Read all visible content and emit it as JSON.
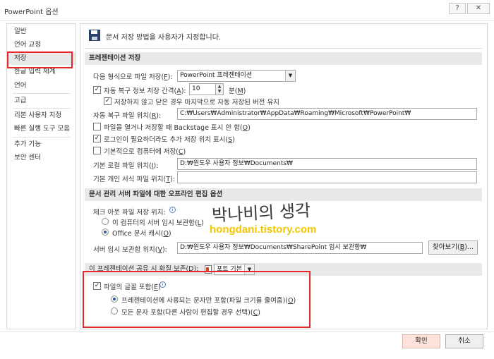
{
  "window": {
    "title": "PowerPoint 옵션",
    "help_label": "?",
    "close_label": "✕"
  },
  "sidebar": {
    "items": [
      {
        "label": "일반"
      },
      {
        "label": "언어 교정"
      },
      {
        "label": "저장",
        "selected": true
      },
      {
        "label": "한글 입력 체계"
      },
      {
        "label": "언어"
      },
      {
        "label": "고급"
      },
      {
        "label": "리본 사용자 지정"
      },
      {
        "label": "빠른 실행 도구 모음"
      },
      {
        "label": "추가 기능"
      },
      {
        "label": "보안 센터"
      }
    ]
  },
  "header": {
    "icon": "save-icon",
    "text": "문서 저장 방법을 사용자가 지정합니다."
  },
  "presentation_save": {
    "heading": "프레젠테이션 저장",
    "format_label": "다음 형식으로 파일 저장(",
    "format_key": "F",
    "format_value": "PowerPoint 프레젠테이션",
    "autorecover_label": "자동 복구 정보 저장 간격(",
    "autorecover_key": "A",
    "autorecover_checked": true,
    "autorecover_minutes": "10",
    "minutes_label": "분(",
    "minutes_key": "M",
    "keep_last_label": "저장하지 않고 닫은 경우 마지막으로 자동 저장된 버전 유지",
    "keep_last_checked": true,
    "autorecover_location_label": "자동 복구 파일 위치(",
    "autorecover_location_key": "R",
    "autorecover_location_value": "C:₩Users₩Administrator₩AppData₩Roaming₩Microsoft₩PowerPoint₩",
    "no_backstage_label": "파일을 열거나 저장할 때 Backstage 표시 안 함(",
    "no_backstage_key": "O",
    "no_backstage_checked": false,
    "show_locations_label": "로그인이 필요하더라도 추가 저장 위치 표시(",
    "show_locations_key": "S",
    "show_locations_checked": true,
    "save_to_computer_label": "기본적으로 컴퓨터에 저장(",
    "save_to_computer_key": "C",
    "save_to_computer_checked": false,
    "default_local_label": "기본 로컬 파일 위치(",
    "default_local_key": "I",
    "default_local_value": "D:₩윈도우 사용자 정보₩Documents₩",
    "default_template_label": "기본 개인 서식 파일 위치(",
    "default_template_key": "T",
    "default_template_value": ""
  },
  "offline_editing": {
    "heading": "문서 관리 서버 파일에 대한 오프라인 편집 옵션",
    "checkout_label": "체크 아웃 파일 저장 위치:",
    "option1_label": "이 컴퓨터의 서버 임시 보관함(",
    "option1_key": "L",
    "option1_selected": false,
    "option2_label": "Office 문서 캐시(",
    "option2_key": "O",
    "option2_selected": true,
    "drafts_label": "서버 임시 보관함 위치(",
    "drafts_key": "V",
    "drafts_value": "D:₩윈도우 사용자 정보₩Documents₩SharePoint 임시 보관함₩",
    "browse_label": "찾아보기(",
    "browse_key": "B",
    "browse_suffix": ")..."
  },
  "fidelity": {
    "heading": "이 프레젠테이션 공유 시 화질 보존(D):",
    "file_value": "포트 기본",
    "embed_fonts_label": "파일의 글꼴 포함(",
    "embed_fonts_key": "E",
    "embed_fonts_checked": true,
    "option1_label": "프레젠테이션에 사용되는 문자만 포함(파일 크기를 줄여줌)(",
    "option1_key": "O",
    "option1_selected": true,
    "option2_label": "모든 문자 포함(다른 사람이 편집할 경우 선택)(",
    "option2_key": "C",
    "option2_selected": false
  },
  "watermark": {
    "korean": "박나비의 생각",
    "url": "hongdani.tistory.com"
  },
  "footer": {
    "ok_label": "확인",
    "cancel_label": "취소"
  },
  "colors": {
    "highlight_box": "#e8262c",
    "selected_item_bg": "#e9e9e9",
    "section_head_bg": "#e9e9e9",
    "ok_button_bg": "#fde3dc",
    "watermark_url": "#f3c600"
  }
}
